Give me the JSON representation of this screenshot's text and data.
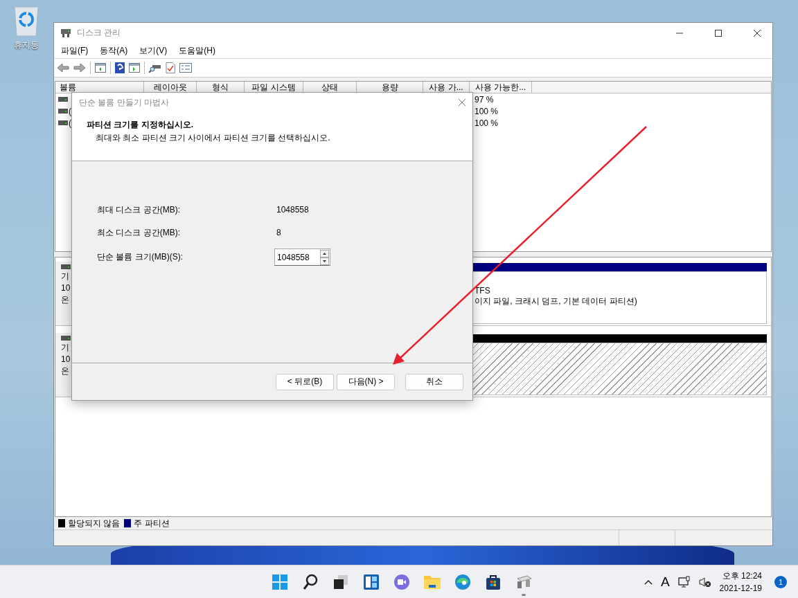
{
  "desktop": {
    "icons": [
      {
        "label": "휴지통"
      }
    ]
  },
  "window": {
    "title": "디스크 관리",
    "menu": [
      "파일(F)",
      "동작(A)",
      "보기(V)",
      "도움말(H)"
    ],
    "columns": [
      "볼륨",
      "레이아웃",
      "형식",
      "파일 시스템",
      "상태",
      "용량",
      "사용 가...",
      "사용 가능한..."
    ],
    "rows": [
      {
        "free_percent": "97 %"
      },
      {
        "volume": "(",
        "free_percent": "100 %"
      },
      {
        "volume": "(",
        "free_percent": "100 %"
      }
    ],
    "disks": [
      {
        "label_lines": [
          "기",
          "10",
          "온"
        ],
        "partition": {
          "kind": "primary",
          "color": "#000080",
          "lines": [
            "TFS",
            "이지 파일, 크래시 덤프, 기본 데이터 파티션)"
          ]
        }
      },
      {
        "label_lines": [
          "기",
          "10",
          "온"
        ],
        "partition": {
          "kind": "unallocated",
          "color": "#000000"
        }
      }
    ],
    "legend": [
      {
        "label": "할당되지 않음",
        "color": "#000000"
      },
      {
        "label": "주 파티션",
        "color": "#000080"
      }
    ]
  },
  "dialog": {
    "title": "단순 볼륨 만들기 마법사",
    "heading": "파티션 크기를 지정하십시오.",
    "subtitle": "최대와 최소 파티션 크기 사이에서 파티션 크기를 선택하십시오.",
    "fields": [
      {
        "kind": "text",
        "label": "최대 디스크 공간(MB):",
        "value": "1048558"
      },
      {
        "kind": "text",
        "label": "최소 디스크 공간(MB):",
        "value": "8"
      },
      {
        "kind": "spin",
        "label": "단순 볼륨 크기(MB)(S):",
        "value": "1048558"
      }
    ],
    "buttons": [
      "< 뒤로(B)",
      "다음(N) >",
      "취소"
    ]
  },
  "taskbar": {
    "apps": [
      {
        "kind": "start"
      },
      {
        "kind": "search"
      },
      {
        "kind": "taskview"
      },
      {
        "kind": "widgets"
      },
      {
        "kind": "chat"
      },
      {
        "kind": "folder"
      },
      {
        "kind": "edge"
      },
      {
        "kind": "store"
      },
      {
        "kind": "disk",
        "running": true
      }
    ],
    "input_indicator": "A",
    "time": "오후 12:24",
    "date": "2021-12-19",
    "notifications": "1"
  }
}
